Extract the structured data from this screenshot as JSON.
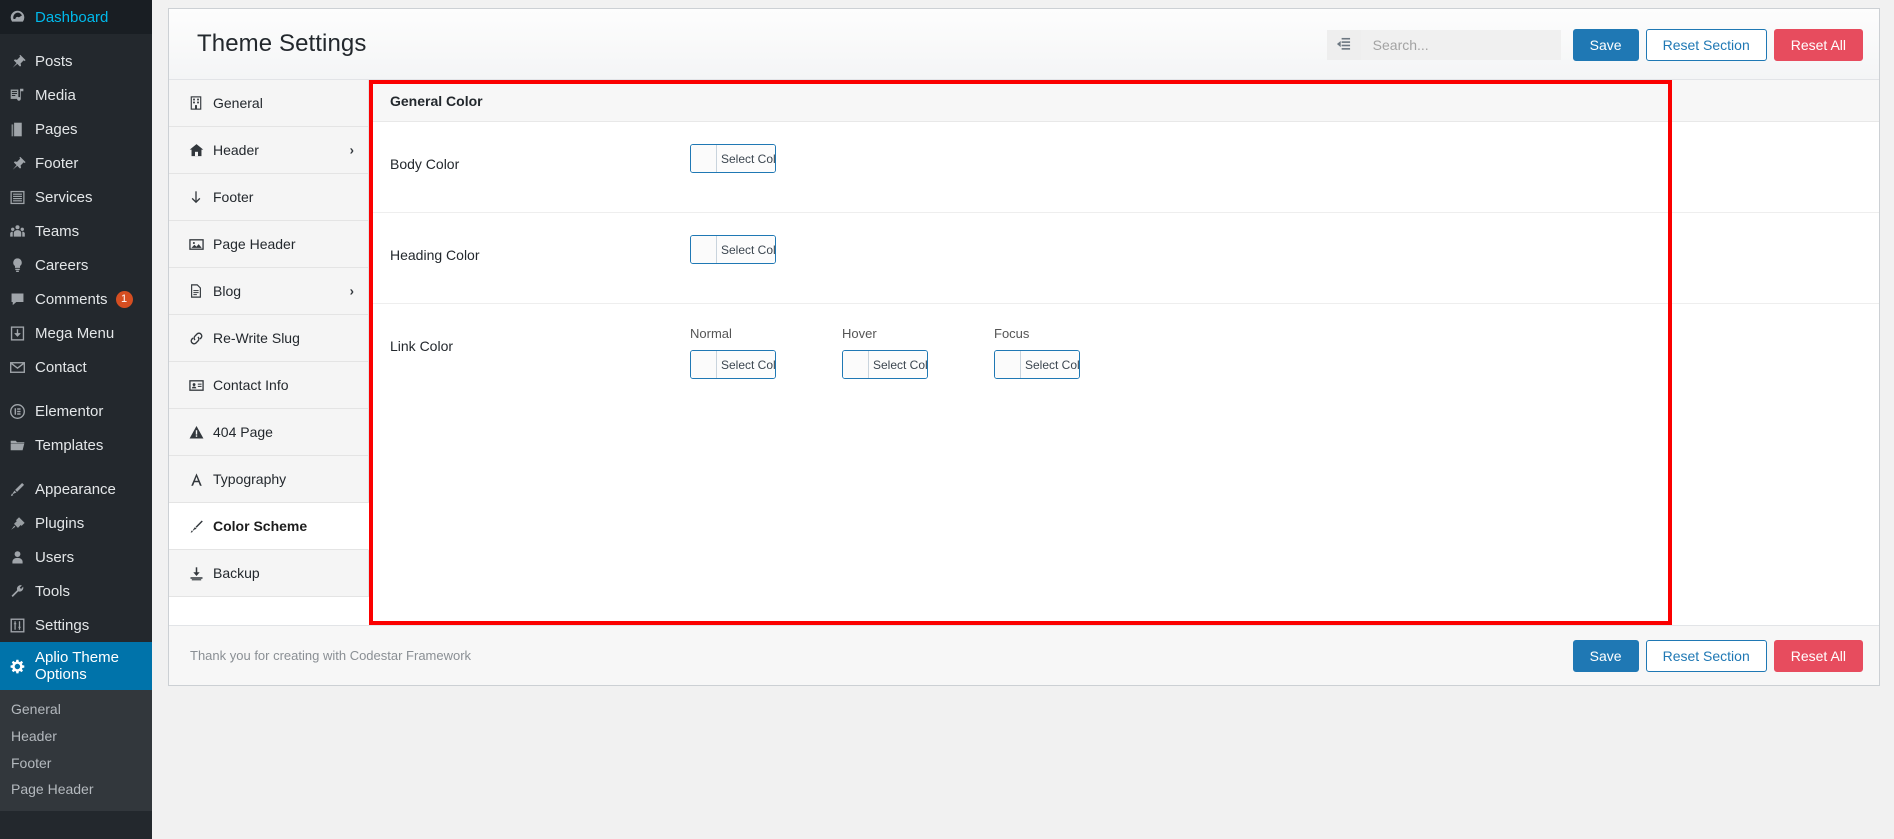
{
  "admin_menu": {
    "items": [
      {
        "label": "Dashboard",
        "icon": "dashboard-icon",
        "name": "sidebar-item-dashboard",
        "gap": false
      },
      {
        "label": "Posts",
        "icon": "pin-icon",
        "name": "sidebar-item-posts",
        "gap": true
      },
      {
        "label": "Media",
        "icon": "media-icon",
        "name": "sidebar-item-media",
        "gap": false
      },
      {
        "label": "Pages",
        "icon": "pages-icon",
        "name": "sidebar-item-pages",
        "gap": false
      },
      {
        "label": "Footer",
        "icon": "pin-icon",
        "name": "sidebar-item-footer",
        "gap": false
      },
      {
        "label": "Services",
        "icon": "list-icon",
        "name": "sidebar-item-services",
        "gap": false
      },
      {
        "label": "Teams",
        "icon": "groups-icon",
        "name": "sidebar-item-teams",
        "gap": false
      },
      {
        "label": "Careers",
        "icon": "lightbulb-icon",
        "name": "sidebar-item-careers",
        "gap": false
      },
      {
        "label": "Comments",
        "icon": "comment-icon",
        "name": "sidebar-item-comments",
        "gap": false,
        "badge": "1"
      },
      {
        "label": "Mega Menu",
        "icon": "download-box-icon",
        "name": "sidebar-item-mega-menu",
        "gap": false
      },
      {
        "label": "Contact",
        "icon": "envelope-icon",
        "name": "sidebar-item-contact",
        "gap": false
      },
      {
        "label": "Elementor",
        "icon": "elementor-icon",
        "name": "sidebar-item-elementor",
        "gap": true
      },
      {
        "label": "Templates",
        "icon": "folder-icon",
        "name": "sidebar-item-templates",
        "gap": false
      },
      {
        "label": "Appearance",
        "icon": "brush-icon",
        "name": "sidebar-item-appearance",
        "gap": true
      },
      {
        "label": "Plugins",
        "icon": "plug-icon",
        "name": "sidebar-item-plugins",
        "gap": false
      },
      {
        "label": "Users",
        "icon": "user-icon",
        "name": "sidebar-item-users",
        "gap": false
      },
      {
        "label": "Tools",
        "icon": "wrench-icon",
        "name": "sidebar-item-tools",
        "gap": false
      },
      {
        "label": "Settings",
        "icon": "sliders-icon",
        "name": "sidebar-item-settings",
        "gap": false
      }
    ],
    "current": {
      "label": "Aplio Theme Options",
      "icon": "gear-icon",
      "name": "sidebar-item-aplio-theme-options"
    },
    "submenu": [
      {
        "label": "General",
        "name": "submenu-item-general"
      },
      {
        "label": "Header",
        "name": "submenu-item-header"
      },
      {
        "label": "Footer",
        "name": "submenu-item-footer"
      },
      {
        "label": "Page Header",
        "name": "submenu-item-page-header"
      }
    ]
  },
  "header": {
    "title": "Theme Settings",
    "expand_icon": "expand-collapse-icon",
    "search_placeholder": "Search...",
    "search_value": "",
    "save_label": "Save",
    "reset_section_label": "Reset Section",
    "reset_all_label": "Reset All"
  },
  "tabs": [
    {
      "label": "General",
      "icon": "building-icon",
      "active": false,
      "arrow": ""
    },
    {
      "label": "Header",
      "icon": "home-icon",
      "active": false,
      "arrow": "›"
    },
    {
      "label": "Footer",
      "icon": "arrow-down-icon",
      "active": false,
      "arrow": ""
    },
    {
      "label": "Page Header",
      "icon": "image-icon",
      "active": false,
      "arrow": ""
    },
    {
      "label": "Blog",
      "icon": "file-icon",
      "active": false,
      "arrow": "›"
    },
    {
      "label": "Re-Write Slug",
      "icon": "link-icon",
      "active": false,
      "arrow": ""
    },
    {
      "label": "Contact Info",
      "icon": "contact-card-icon",
      "active": false,
      "arrow": ""
    },
    {
      "label": "404 Page",
      "icon": "warning-icon",
      "active": false,
      "arrow": ""
    },
    {
      "label": "Typography",
      "icon": "font-icon",
      "active": false,
      "arrow": ""
    },
    {
      "label": "Color Scheme",
      "icon": "paintbrush-icon",
      "active": true,
      "arrow": ""
    },
    {
      "label": "Backup",
      "icon": "download-icon",
      "active": false,
      "arrow": ""
    }
  ],
  "section": {
    "title": "General Color",
    "fields": [
      {
        "label": "Body Color",
        "name": "field-body-color",
        "controls": [
          {
            "group_label": "",
            "button_label": "Select Color",
            "swatch": "#fbfbfb"
          }
        ]
      },
      {
        "label": "Heading Color",
        "name": "field-heading-color",
        "controls": [
          {
            "group_label": "",
            "button_label": "Select Color",
            "swatch": "#fbfbfb"
          }
        ]
      },
      {
        "label": "Link Color",
        "name": "field-link-color",
        "controls": [
          {
            "group_label": "Normal",
            "button_label": "Select Color",
            "swatch": "#fbfbfb"
          },
          {
            "group_label": "Hover",
            "button_label": "Select Color",
            "swatch": "#fbfbfb"
          },
          {
            "group_label": "Focus",
            "button_label": "Select Color",
            "swatch": "#fbfbfb"
          }
        ]
      }
    ]
  },
  "footer": {
    "credit": "Thank you for creating with Codestar Framework",
    "save_label": "Save",
    "reset_section_label": "Reset Section",
    "reset_all_label": "Reset All"
  },
  "colors": {
    "accent_blue": "#1f78b4",
    "danger_red": "#e74c5e",
    "highlight_red": "#fb0000",
    "admin_bg": "#23282d",
    "admin_current": "#0073aa",
    "submenu_bg": "#32373c"
  }
}
